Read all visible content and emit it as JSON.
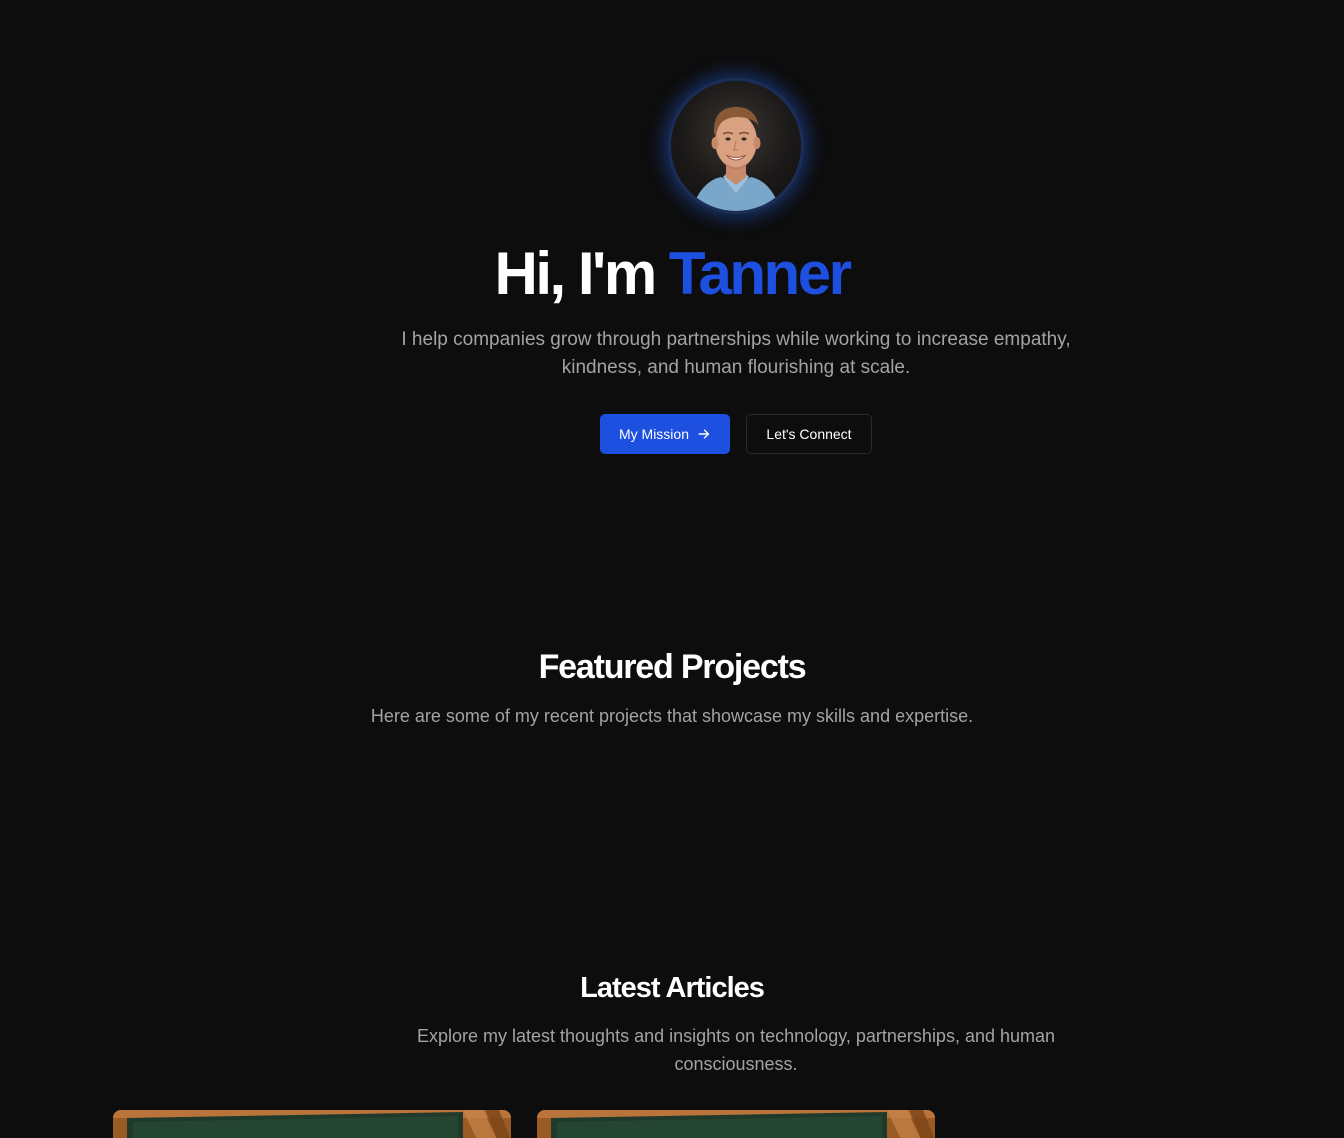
{
  "hero": {
    "title_prefix": "Hi, I'm ",
    "title_name": "Tanner",
    "subtitle": "I help companies grow through partnerships while working to increase empathy, kindness, and human flourishing at scale.",
    "primary_button": "My Mission",
    "secondary_button": "Let's Connect",
    "accent_color": "#1d4fe0"
  },
  "projects": {
    "title": "Featured Projects",
    "subtitle": "Here are some of my recent projects that showcase my skills and expertise."
  },
  "articles": {
    "title": "Latest Articles",
    "subtitle": "Explore my latest thoughts and insights on technology, partnerships, and human consciousness.",
    "cards": [
      {
        "image": "chalkboard-image"
      },
      {
        "image": "chalkboard-image"
      }
    ]
  },
  "icons": {
    "primary_button_icon": "arrow-right-icon"
  }
}
